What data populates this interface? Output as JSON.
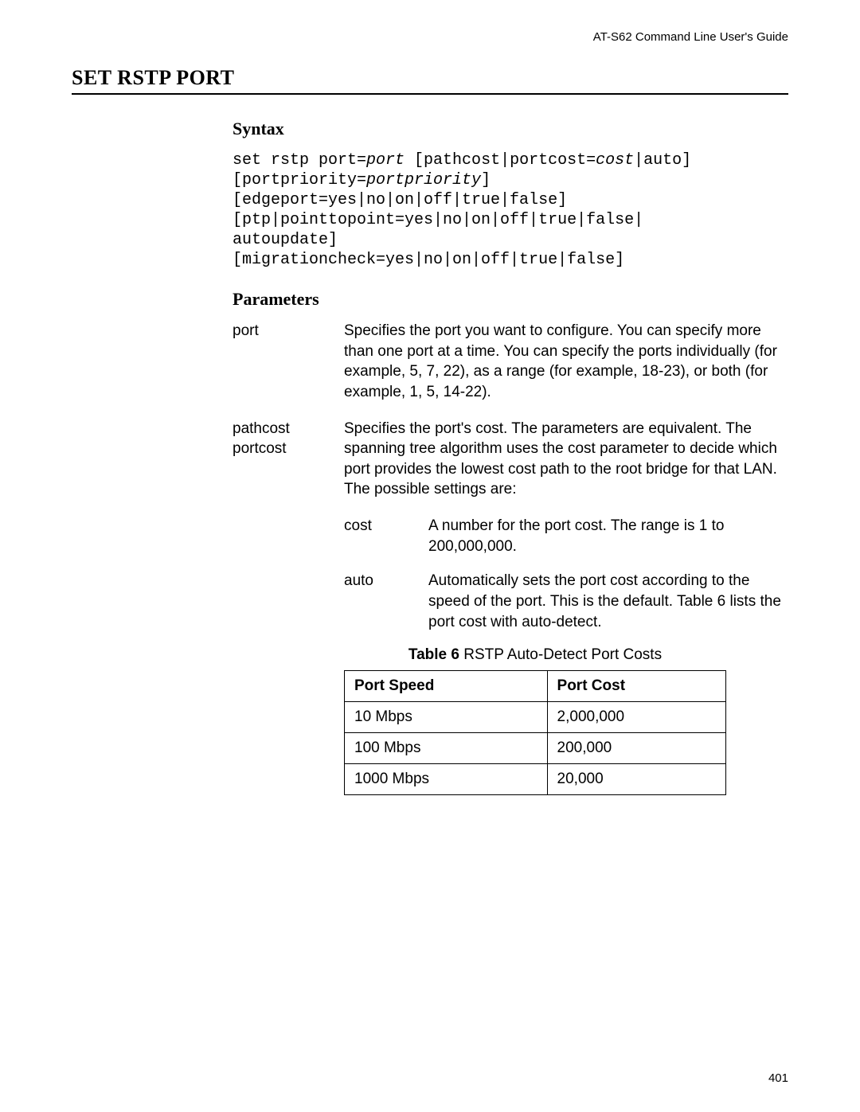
{
  "running_head": "AT-S62 Command Line User's Guide",
  "section_title": "SET RSTP PORT",
  "syntax_heading": "Syntax",
  "syntax_lines": [
    [
      {
        "t": "set rstp port="
      },
      {
        "t": "port",
        "i": true
      },
      {
        "t": " [pathcost|portcost="
      },
      {
        "t": "cost",
        "i": true
      },
      {
        "t": "|auto]"
      }
    ],
    [
      {
        "t": "[portpriority="
      },
      {
        "t": "portpriority",
        "i": true
      },
      {
        "t": "]"
      }
    ],
    [
      {
        "t": "[edgeport=yes|no|on|off|true|false]"
      }
    ],
    [
      {
        "t": "[ptp|pointtopoint=yes|no|on|off|true|false|"
      }
    ],
    [
      {
        "t": "autoupdate]"
      }
    ],
    [
      {
        "t": "[migrationcheck=yes|no|on|off|true|false]"
      }
    ]
  ],
  "parameters_heading": "Parameters",
  "params": [
    {
      "term": "port",
      "desc": "Specifies the port you want to configure. You can specify more than one port at a time. You can specify the ports individually (for example, 5, 7, 22), as a range (for example, 18-23), or both (for example, 1, 5, 14-22)."
    },
    {
      "term": "pathcost\nportcost",
      "desc": "Specifies the port's cost. The parameters are equivalent. The spanning tree algorithm uses the cost parameter to decide which port provides the lowest cost path to the root bridge for that LAN. The possible settings are:"
    }
  ],
  "sub_params": [
    {
      "term": "cost",
      "desc": "A number for the port cost. The range is 1 to 200,000,000."
    },
    {
      "term": "auto",
      "desc": "Automatically sets the port cost according to the speed of the port. This is the default. Table 6 lists the port cost with auto-detect."
    }
  ],
  "table_caption_bold": "Table 6",
  "table_caption_rest": "  RSTP Auto-Detect Port Costs",
  "chart_data": {
    "type": "table",
    "title": "RSTP Auto-Detect Port Costs",
    "columns": [
      "Port Speed",
      "Port Cost"
    ],
    "rows": [
      [
        "10 Mbps",
        "2,000,000"
      ],
      [
        "100 Mbps",
        "200,000"
      ],
      [
        "1000 Mbps",
        "20,000"
      ]
    ]
  },
  "page_number": "401"
}
